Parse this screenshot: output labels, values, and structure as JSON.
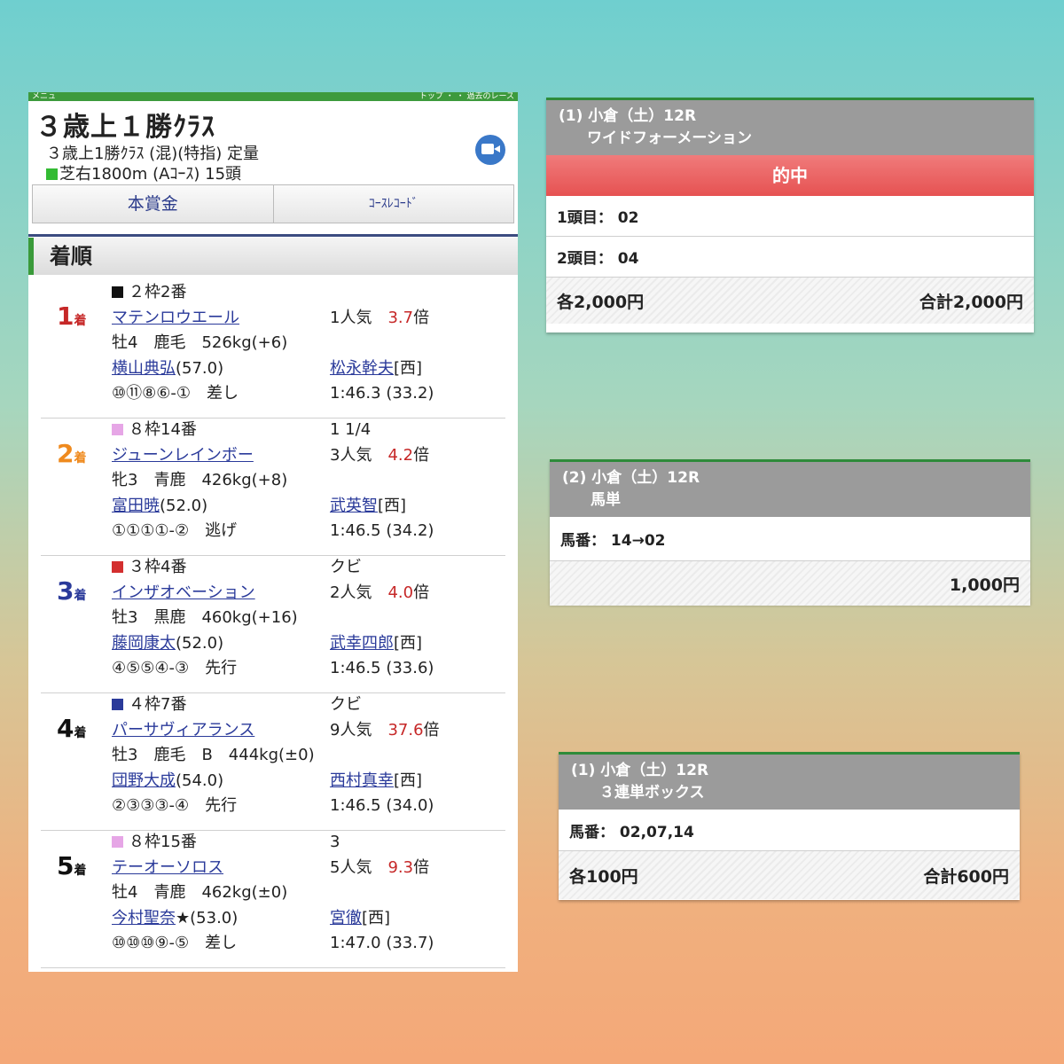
{
  "results": {
    "top_left": "メニュ",
    "top_right": "トップ ・ ・ 過去のレース",
    "title": "３歳上１勝ｸﾗｽ",
    "subtitle": "３歳上1勝ｸﾗｽ (混)(特指) 定量",
    "course": "芝右1800m (Aｺｰｽ) 15頭",
    "tabs": [
      "本賞金",
      "ｺｰｽﾚｺｰﾄﾞ"
    ],
    "section_title": "着順",
    "entries": [
      {
        "rank": "1",
        "rank_suffix": "着",
        "rank_color": "#c62828",
        "frame": "２枠2番",
        "frame_color": "#111111",
        "horse": "マテンロウエール",
        "margin": "",
        "popularity": "1人気",
        "odds": "3.7",
        "odds_unit": "倍",
        "details": "牡4　鹿毛　526kg(+6)",
        "jockey": "横山典弘",
        "weight": "(57.0)",
        "trainer": "松永幹夫",
        "region": "[西]",
        "passing": "⑩⑪⑧⑥-①　差し",
        "time": "1:46.3 (33.2)"
      },
      {
        "rank": "2",
        "rank_suffix": "着",
        "rank_color": "#ef8a1e",
        "frame": "８枠14番",
        "frame_color": "#e6a6e6",
        "horse": "ジューンレインボー",
        "margin": "1 1/4",
        "popularity": "3人気",
        "odds": "4.2",
        "odds_unit": "倍",
        "details": "牝3　青鹿　426kg(+8)",
        "jockey": "富田暁",
        "weight": "(52.0)",
        "trainer": "武英智",
        "region": "[西]",
        "passing": "①①①①-②　逃げ",
        "time": "1:46.5 (34.2)"
      },
      {
        "rank": "3",
        "rank_suffix": "着",
        "rank_color": "#2a3a9a",
        "frame": "３枠4番",
        "frame_color": "#d32f2f",
        "horse": "インザオベーション",
        "margin": "クビ",
        "popularity": "2人気",
        "odds": "4.0",
        "odds_unit": "倍",
        "details": "牡3　黒鹿　460kg(+16)",
        "jockey": "藤岡康太",
        "weight": "(52.0)",
        "trainer": "武幸四郎",
        "region": "[西]",
        "passing": "④⑤⑤④-③　先行",
        "time": "1:46.5 (33.6)"
      },
      {
        "rank": "4",
        "rank_suffix": "着",
        "rank_color": "#111111",
        "frame": "４枠7番",
        "frame_color": "#2a3a9a",
        "horse": "パーサヴィアランス",
        "margin": "クビ",
        "popularity": "9人気",
        "odds": "37.6",
        "odds_unit": "倍",
        "details": "牡3　鹿毛　B　444kg(±0)",
        "jockey": "団野大成",
        "weight": "(54.0)",
        "trainer": "西村真幸",
        "region": "[西]",
        "passing": "②③③③-④　先行",
        "time": "1:46.5 (34.0)"
      },
      {
        "rank": "5",
        "rank_suffix": "着",
        "rank_color": "#111111",
        "frame": "８枠15番",
        "frame_color": "#e6a6e6",
        "horse": "テーオーソロス",
        "margin": "3",
        "popularity": "5人気",
        "odds": "9.3",
        "odds_unit": "倍",
        "details": "牡4　青鹿　462kg(±0)",
        "jockey": "今村聖奈",
        "weight": "★(53.0)",
        "trainer": "宮徹",
        "region": "[西]",
        "passing": "⑩⑩⑩⑨-⑤　差し",
        "time": "1:47.0 (33.7)"
      }
    ]
  },
  "bets": [
    {
      "race": "(1) 小倉（土）12R",
      "type": "ワイドフォーメーション",
      "hit": "的中",
      "rows": [
        "1頭目：  02",
        "2頭目：  04"
      ],
      "each": "各2,000円",
      "total": "合計2,000円"
    },
    {
      "race": "(2) 小倉（土）12R",
      "type": "馬単",
      "rows": [
        "馬番：  14→02"
      ],
      "each": "",
      "total": "1,000円"
    },
    {
      "race": "(1) 小倉（土）12R",
      "type": "３連単ボックス",
      "rows": [
        "馬番：  02,07,14"
      ],
      "each": "各100円",
      "total": "合計600円"
    }
  ]
}
